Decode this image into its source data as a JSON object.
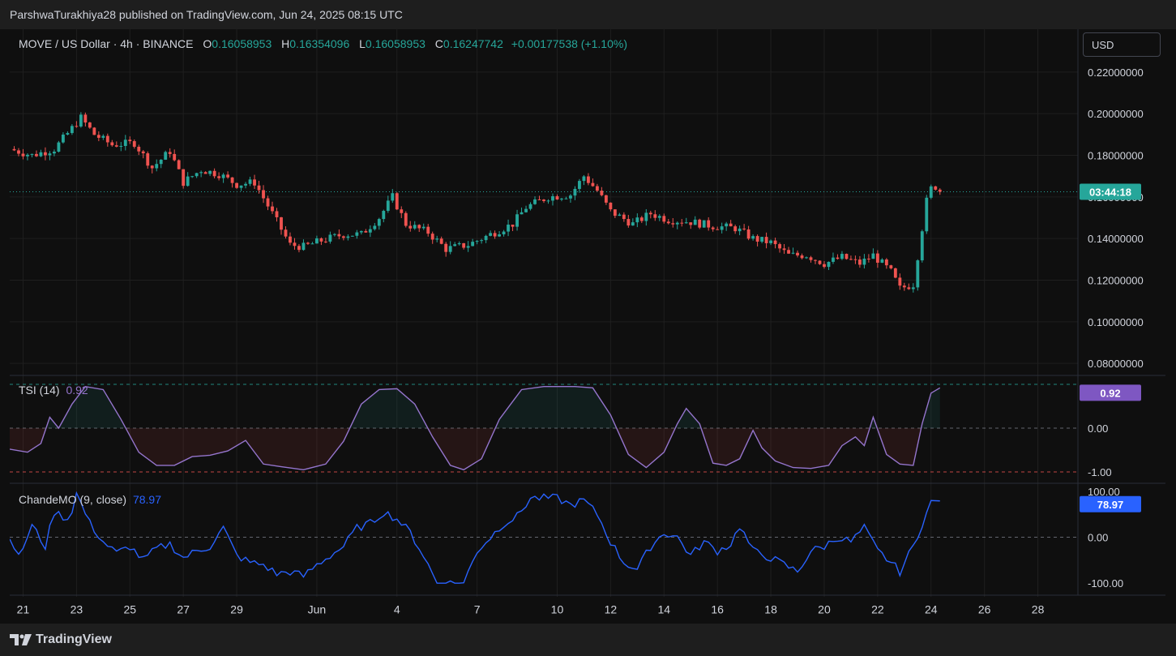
{
  "header": {
    "publisher": "ParshwaTurakhiya28 published on TradingView.com, Jun 24, 2025 08:15 UTC"
  },
  "symbol": {
    "name": "MOVE / US Dollar · 4h · BINANCE",
    "o_label": "O",
    "o": "0.16058953",
    "h_label": "H",
    "h": "0.16354096",
    "l_label": "L",
    "l": "0.16058953",
    "c_label": "C",
    "c": "0.16247742",
    "change": "+0.00177538 (+1.10%)"
  },
  "currency": "USD",
  "countdown": "03:44:18",
  "tsi_label": "TSI (14)",
  "tsi_value": "0.92",
  "chande_label": "ChandeMO (9, close)",
  "chande_value": "78.97",
  "footer": {
    "brand": "TradingView"
  },
  "colors": {
    "up": "#26a69a",
    "down": "#ef5350",
    "tsi": "#9575cd",
    "tsi_badge": "#7e57c2",
    "chande": "#2962ff",
    "grid": "#1f1f1f",
    "background": "#0f0f0f"
  },
  "chart_data": [
    {
      "type": "candlestick",
      "title": "MOVE / US Dollar · 4h · BINANCE",
      "x_ticks": [
        [
          "21",
          "2025-05-21"
        ],
        [
          "23",
          "2025-05-23"
        ],
        [
          "25",
          "2025-05-25"
        ],
        [
          "27",
          "2025-05-27"
        ],
        [
          "29",
          "2025-05-29"
        ],
        [
          "Jun",
          "2025-06-01"
        ],
        [
          "4",
          "2025-06-04"
        ],
        [
          "7",
          "2025-06-07"
        ],
        [
          "10",
          "2025-06-10"
        ],
        [
          "12",
          "2025-06-12"
        ],
        [
          "14",
          "2025-06-14"
        ],
        [
          "16",
          "2025-06-16"
        ],
        [
          "18",
          "2025-06-18"
        ],
        [
          "20",
          "2025-06-20"
        ],
        [
          "22",
          "2025-06-22"
        ],
        [
          "24",
          "2025-06-24"
        ],
        [
          "26",
          "2025-06-26"
        ],
        [
          "28",
          "2025-06-28"
        ]
      ],
      "y_ticks": [
        0.08,
        0.1,
        0.12,
        0.14,
        0.16,
        0.18,
        0.2,
        0.22
      ],
      "y_tick_labels": [
        "0.08000000",
        "0.10000000",
        "0.12000000",
        "0.14000000",
        "0.16000000",
        "0.18000000",
        "0.20000000",
        "0.22000000"
      ],
      "ylim": [
        0.075,
        0.225
      ],
      "xlim": [
        "2025-05-20 12:00",
        "2025-06-29 12:00"
      ],
      "last_price": 0.16247742,
      "anchors": [
        [
          "2025-05-20 12:00",
          0.183
        ],
        [
          "2025-05-21 08:00",
          0.18
        ],
        [
          "2025-05-22 04:00",
          0.183
        ],
        [
          "2025-05-22 20:00",
          0.193
        ],
        [
          "2025-05-23 04:00",
          0.198
        ],
        [
          "2025-05-23 16:00",
          0.19
        ],
        [
          "2025-05-24 08:00",
          0.185
        ],
        [
          "2025-05-25 04:00",
          0.186
        ],
        [
          "2025-05-25 20:00",
          0.174
        ],
        [
          "2025-05-26 12:00",
          0.182
        ],
        [
          "2025-05-27 00:00",
          0.167
        ],
        [
          "2025-05-27 16:00",
          0.173
        ],
        [
          "2025-05-28 08:00",
          0.171
        ],
        [
          "2025-05-29 00:00",
          0.166
        ],
        [
          "2025-05-29 16:00",
          0.167
        ],
        [
          "2025-05-30 08:00",
          0.152
        ],
        [
          "2025-05-31 00:00",
          0.137
        ],
        [
          "2025-05-31 12:00",
          0.136
        ],
        [
          "2025-06-01 04:00",
          0.139
        ],
        [
          "2025-06-02 00:00",
          0.142
        ],
        [
          "2025-06-02 16:00",
          0.142
        ],
        [
          "2025-06-03 08:00",
          0.15
        ],
        [
          "2025-06-03 20:00",
          0.16
        ],
        [
          "2025-06-04 08:00",
          0.147
        ],
        [
          "2025-06-05 04:00",
          0.143
        ],
        [
          "2025-06-05 20:00",
          0.135
        ],
        [
          "2025-06-06 16:00",
          0.137
        ],
        [
          "2025-06-07 12:00",
          0.142
        ],
        [
          "2025-06-08 08:00",
          0.147
        ],
        [
          "2025-06-08 20:00",
          0.155
        ],
        [
          "2025-06-09 16:00",
          0.16
        ],
        [
          "2025-06-10 12:00",
          0.161
        ],
        [
          "2025-06-11 00:00",
          0.17
        ],
        [
          "2025-06-11 12:00",
          0.163
        ],
        [
          "2025-06-12 00:00",
          0.153
        ],
        [
          "2025-06-12 20:00",
          0.147
        ],
        [
          "2025-06-13 12:00",
          0.152
        ],
        [
          "2025-06-14 04:00",
          0.149
        ],
        [
          "2025-06-15 00:00",
          0.148
        ],
        [
          "2025-06-15 20:00",
          0.146
        ],
        [
          "2025-06-16 16:00",
          0.145
        ],
        [
          "2025-06-17 08:00",
          0.14
        ],
        [
          "2025-06-18 00:00",
          0.138
        ],
        [
          "2025-06-18 16:00",
          0.132
        ],
        [
          "2025-06-19 08:00",
          0.132
        ],
        [
          "2025-06-20 00:00",
          0.128
        ],
        [
          "2025-06-20 16:00",
          0.131
        ],
        [
          "2025-06-21 08:00",
          0.128
        ],
        [
          "2025-06-21 20:00",
          0.132
        ],
        [
          "2025-06-22 12:00",
          0.124
        ],
        [
          "2025-06-22 20:00",
          0.116
        ],
        [
          "2025-06-23 08:00",
          0.118
        ],
        [
          "2025-06-23 16:00",
          0.145
        ],
        [
          "2025-06-23 20:00",
          0.158
        ],
        [
          "2025-06-24 00:00",
          0.164
        ],
        [
          "2025-06-24 04:00",
          0.165
        ],
        [
          "2025-06-24 08:00",
          0.1625
        ]
      ]
    },
    {
      "type": "line",
      "name": "TSI (14)",
      "y_ticks": [
        -1.0,
        0.0
      ],
      "y_tick_labels": [
        "-1.00",
        "0.00"
      ],
      "ylim": [
        -1.0,
        1.0
      ],
      "levels": [
        1.0,
        0.0,
        -1.0
      ],
      "last_value": 0.92,
      "anchors": [
        [
          "2025-05-20 12:00",
          -0.48
        ],
        [
          "2025-05-21 04:00",
          -0.55
        ],
        [
          "2025-05-21 16:00",
          -0.35
        ],
        [
          "2025-05-22 00:00",
          0.25
        ],
        [
          "2025-05-22 08:00",
          0.0
        ],
        [
          "2025-05-22 20:00",
          0.55
        ],
        [
          "2025-05-23 08:00",
          0.95
        ],
        [
          "2025-05-24 00:00",
          0.88
        ],
        [
          "2025-05-24 16:00",
          0.2
        ],
        [
          "2025-05-25 08:00",
          -0.55
        ],
        [
          "2025-05-26 00:00",
          -0.85
        ],
        [
          "2025-05-26 16:00",
          -0.85
        ],
        [
          "2025-05-27 08:00",
          -0.65
        ],
        [
          "2025-05-28 00:00",
          -0.62
        ],
        [
          "2025-05-28 16:00",
          -0.52
        ],
        [
          "2025-05-29 08:00",
          -0.28
        ],
        [
          "2025-05-30 00:00",
          -0.82
        ],
        [
          "2025-05-30 16:00",
          -0.88
        ],
        [
          "2025-05-31 12:00",
          -0.95
        ],
        [
          "2025-06-01 08:00",
          -0.82
        ],
        [
          "2025-06-02 00:00",
          -0.3
        ],
        [
          "2025-06-02 16:00",
          0.55
        ],
        [
          "2025-06-03 08:00",
          0.88
        ],
        [
          "2025-06-04 00:00",
          0.9
        ],
        [
          "2025-06-04 16:00",
          0.55
        ],
        [
          "2025-06-05 08:00",
          -0.2
        ],
        [
          "2025-06-06 00:00",
          -0.85
        ],
        [
          "2025-06-06 12:00",
          -0.95
        ],
        [
          "2025-06-07 04:00",
          -0.7
        ],
        [
          "2025-06-07 20:00",
          0.2
        ],
        [
          "2025-06-08 16:00",
          0.88
        ],
        [
          "2025-06-09 12:00",
          0.95
        ],
        [
          "2025-06-10 16:00",
          0.95
        ],
        [
          "2025-06-11 08:00",
          0.92
        ],
        [
          "2025-06-12 00:00",
          0.3
        ],
        [
          "2025-06-12 16:00",
          -0.6
        ],
        [
          "2025-06-13 08:00",
          -0.9
        ],
        [
          "2025-06-14 00:00",
          -0.55
        ],
        [
          "2025-06-14 12:00",
          0.1
        ],
        [
          "2025-06-14 20:00",
          0.45
        ],
        [
          "2025-06-15 08:00",
          0.1
        ],
        [
          "2025-06-15 20:00",
          -0.8
        ],
        [
          "2025-06-16 08:00",
          -0.85
        ],
        [
          "2025-06-16 20:00",
          -0.7
        ],
        [
          "2025-06-17 08:00",
          -0.05
        ],
        [
          "2025-06-17 16:00",
          -0.45
        ],
        [
          "2025-06-18 04:00",
          -0.75
        ],
        [
          "2025-06-18 20:00",
          -0.9
        ],
        [
          "2025-06-19 12:00",
          -0.92
        ],
        [
          "2025-06-20 04:00",
          -0.85
        ],
        [
          "2025-06-20 16:00",
          -0.4
        ],
        [
          "2025-06-21 04:00",
          -0.2
        ],
        [
          "2025-06-21 12:00",
          -0.4
        ],
        [
          "2025-06-21 20:00",
          0.25
        ],
        [
          "2025-06-22 08:00",
          -0.6
        ],
        [
          "2025-06-22 20:00",
          -0.82
        ],
        [
          "2025-06-23 08:00",
          -0.85
        ],
        [
          "2025-06-23 16:00",
          0.1
        ],
        [
          "2025-06-24 00:00",
          0.8
        ],
        [
          "2025-06-24 08:00",
          0.92
        ]
      ]
    },
    {
      "type": "line",
      "name": "ChandeMO (9, close)",
      "y_ticks": [
        -100,
        0,
        100
      ],
      "y_tick_labels": [
        "-100.00",
        "0.00",
        "100.00"
      ],
      "ylim": [
        -105,
        105
      ],
      "levels": [
        0
      ],
      "last_value": 78.97,
      "anchors": [
        [
          "2025-05-20 12:00",
          5
        ],
        [
          "2025-05-20 20:00",
          -45
        ],
        [
          "2025-05-21 08:00",
          25
        ],
        [
          "2025-05-21 20:00",
          -20
        ],
        [
          "2025-05-22 04:00",
          55
        ],
        [
          "2025-05-22 16:00",
          40
        ],
        [
          "2025-05-22 20:00",
          60
        ],
        [
          "2025-05-23 00:00",
          95
        ],
        [
          "2025-05-23 12:00",
          30
        ],
        [
          "2025-05-24 00:00",
          -10
        ],
        [
          "2025-05-24 12:00",
          -35
        ],
        [
          "2025-05-25 00:00",
          -20
        ],
        [
          "2025-05-25 12:00",
          -50
        ],
        [
          "2025-05-26 00:00",
          -25
        ],
        [
          "2025-05-26 12:00",
          -15
        ],
        [
          "2025-05-27 00:00",
          -45
        ],
        [
          "2025-05-27 12:00",
          -30
        ],
        [
          "2025-05-28 00:00",
          -20
        ],
        [
          "2025-05-28 12:00",
          20
        ],
        [
          "2025-05-29 00:00",
          -40
        ],
        [
          "2025-05-29 12:00",
          -55
        ],
        [
          "2025-05-30 00:00",
          -60
        ],
        [
          "2025-05-30 12:00",
          -80
        ],
        [
          "2025-05-31 00:00",
          -75
        ],
        [
          "2025-05-31 12:00",
          -85
        ],
        [
          "2025-06-01 00:00",
          -60
        ],
        [
          "2025-06-01 12:00",
          -40
        ],
        [
          "2025-06-02 00:00",
          -20
        ],
        [
          "2025-06-02 12:00",
          20
        ],
        [
          "2025-06-03 00:00",
          30
        ],
        [
          "2025-06-03 12:00",
          55
        ],
        [
          "2025-06-04 00:00",
          40
        ],
        [
          "2025-06-04 12:00",
          10
        ],
        [
          "2025-06-05 00:00",
          -40
        ],
        [
          "2025-06-05 12:00",
          -100
        ],
        [
          "2025-06-06 12:00",
          -100
        ],
        [
          "2025-06-07 00:00",
          -30
        ],
        [
          "2025-06-07 12:00",
          0
        ],
        [
          "2025-06-08 00:00",
          30
        ],
        [
          "2025-06-08 12:00",
          45
        ],
        [
          "2025-06-09 00:00",
          85
        ],
        [
          "2025-06-10 00:00",
          85
        ],
        [
          "2025-06-10 12:00",
          70
        ],
        [
          "2025-06-11 00:00",
          80
        ],
        [
          "2025-06-11 12:00",
          50
        ],
        [
          "2025-06-12 00:00",
          -10
        ],
        [
          "2025-06-12 12:00",
          -55
        ],
        [
          "2025-06-13 00:00",
          -70
        ],
        [
          "2025-06-13 12:00",
          -20
        ],
        [
          "2025-06-14 00:00",
          10
        ],
        [
          "2025-06-14 12:00",
          0
        ],
        [
          "2025-06-15 00:00",
          -40
        ],
        [
          "2025-06-15 12:00",
          -10
        ],
        [
          "2025-06-16 00:00",
          -30
        ],
        [
          "2025-06-16 12:00",
          -15
        ],
        [
          "2025-06-16 20:00",
          25
        ],
        [
          "2025-06-17 08:00",
          -30
        ],
        [
          "2025-06-18 00:00",
          -45
        ],
        [
          "2025-06-18 12:00",
          -60
        ],
        [
          "2025-06-19 00:00",
          -75
        ],
        [
          "2025-06-19 12:00",
          -30
        ],
        [
          "2025-06-20 00:00",
          -20
        ],
        [
          "2025-06-20 12:00",
          0
        ],
        [
          "2025-06-21 00:00",
          -10
        ],
        [
          "2025-06-21 12:00",
          20
        ],
        [
          "2025-06-22 00:00",
          -30
        ],
        [
          "2025-06-22 12:00",
          -55
        ],
        [
          "2025-06-22 20:00",
          -75
        ],
        [
          "2025-06-23 08:00",
          -20
        ],
        [
          "2025-06-23 16:00",
          30
        ],
        [
          "2025-06-24 00:00",
          75
        ],
        [
          "2025-06-24 08:00",
          78.97
        ]
      ]
    }
  ]
}
